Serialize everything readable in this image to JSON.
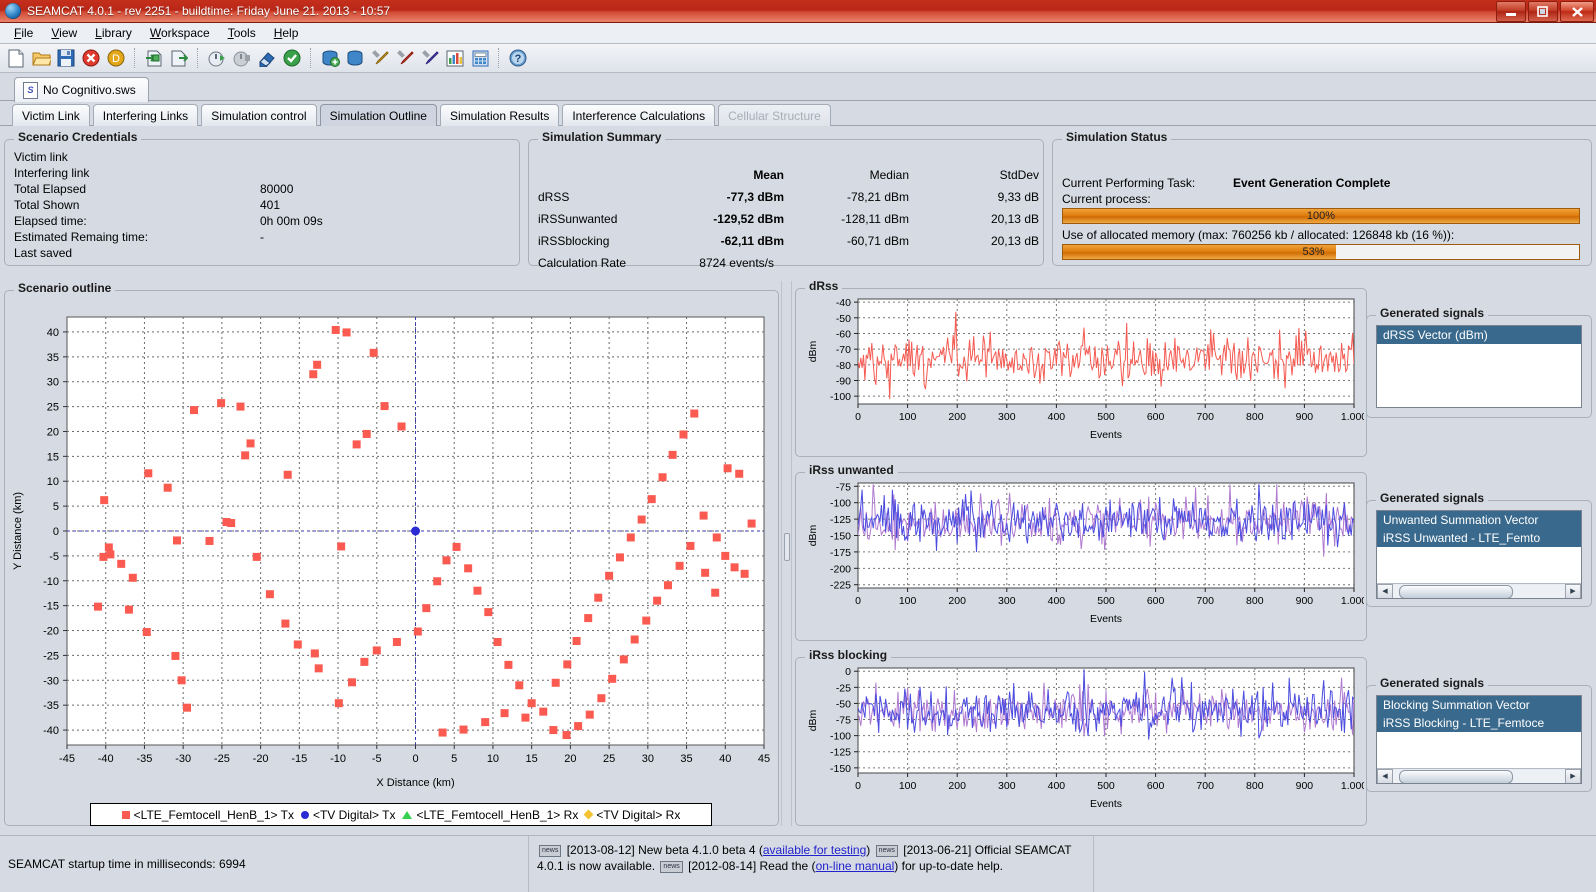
{
  "window": {
    "title": "SEAMCAT 4.0.1 - rev 2251 - buildtime: Friday June 21. 2013 - 10:57",
    "minimize": "—",
    "maximize": "❐",
    "close": "✕"
  },
  "menubar": {
    "items": [
      "File",
      "View",
      "Library",
      "Workspace",
      "Tools",
      "Help"
    ]
  },
  "toolbar": {
    "icons": [
      {
        "name": "new-file-icon",
        "glyph": "📄"
      },
      {
        "name": "open-folder-icon",
        "glyph": "📂"
      },
      {
        "name": "save-icon",
        "glyph": "💾"
      },
      {
        "name": "delete-icon",
        "glyph": "⊗"
      },
      {
        "name": "duplicate-icon",
        "glyph": "D"
      },
      {
        "name": "import-icon",
        "glyph": "⇥"
      },
      {
        "name": "export-icon",
        "glyph": "⇨"
      },
      {
        "name": "run-simulation-icon",
        "glyph": "⏱"
      },
      {
        "name": "stop-simulation-icon",
        "glyph": "⏱"
      },
      {
        "name": "clear-icon",
        "glyph": "◨"
      },
      {
        "name": "validate-icon",
        "glyph": "✔"
      },
      {
        "name": "new-library-icon",
        "glyph": "🗃"
      },
      {
        "name": "library-icon",
        "glyph": "🗄"
      },
      {
        "name": "tools-yellow-icon",
        "glyph": "⚒"
      },
      {
        "name": "tools-red-icon",
        "glyph": "⚒"
      },
      {
        "name": "tools-blue-icon",
        "glyph": "⚒"
      },
      {
        "name": "chart-icon",
        "glyph": "📊"
      },
      {
        "name": "calculator-icon",
        "glyph": "🧮"
      },
      {
        "name": "help-icon",
        "glyph": "?"
      }
    ]
  },
  "file_tab": {
    "label": "No Cognitivo.sws",
    "icon": "S"
  },
  "main_tabs": [
    {
      "label": "Victim Link",
      "active": false,
      "disabled": false
    },
    {
      "label": "Interfering Links",
      "active": false,
      "disabled": false
    },
    {
      "label": "Simulation control",
      "active": false,
      "disabled": false
    },
    {
      "label": "Simulation Outline",
      "active": true,
      "disabled": false
    },
    {
      "label": "Simulation Results",
      "active": false,
      "disabled": false
    },
    {
      "label": "Interference Calculations",
      "active": false,
      "disabled": false
    },
    {
      "label": "Cellular Structure",
      "active": false,
      "disabled": true
    }
  ],
  "scenario_credentials": {
    "title": "Scenario Credentials",
    "rows": [
      {
        "label": "Victim link",
        "value": ""
      },
      {
        "label": "Interfering link",
        "value": ""
      },
      {
        "label": "Total Elapsed",
        "value": "80000"
      },
      {
        "label": "Total Shown",
        "value": "401"
      },
      {
        "label": "Elapsed time:",
        "value": "0h 00m 09s"
      },
      {
        "label": "Estimated Remaing time:",
        "value": "-"
      },
      {
        "label": "Last saved",
        "value": ""
      }
    ]
  },
  "simulation_summary": {
    "title": "Simulation Summary",
    "headers": [
      "",
      "Mean",
      "Median",
      "StdDev"
    ],
    "rows": [
      {
        "name": "dRSS",
        "mean": "-77,3 dBm",
        "median": "-78,21 dBm",
        "stddev": "9,33 dB"
      },
      {
        "name": "iRSSunwanted",
        "mean": "-129,52 dBm",
        "median": "-128,11 dBm",
        "stddev": "20,13 dB"
      },
      {
        "name": "iRSSblocking",
        "mean": "-62,11 dBm",
        "median": "-60,71 dBm",
        "stddev": "20,13 dB"
      },
      {
        "name": "Calculation Rate",
        "mean": "8724 events/s",
        "median": "",
        "stddev": ""
      }
    ]
  },
  "simulation_status": {
    "title": "Simulation Status",
    "task_label": "Current Performing Task:",
    "task_value": "Event Generation Complete",
    "process_label": "Current process:",
    "process_percent": 100,
    "process_text": "100%",
    "memory_label": "Use of allocated memory (max: 760256 kb / allocated: 126848 kb (16 %)):",
    "memory_percent": 53,
    "memory_text": "53%",
    "bar_color": "#e07e10"
  },
  "scenario_outline": {
    "title": "Scenario outline",
    "legend": [
      {
        "marker": "square",
        "color": "#fa5a50",
        "label": "<LTE_Femtocell_HenB_1> Tx"
      },
      {
        "marker": "circle",
        "color": "#2b2bd4",
        "label": "<TV Digital> Tx"
      },
      {
        "marker": "triangle",
        "color": "#33d14f",
        "label": "<LTE_Femtocell_HenB_1> Rx"
      },
      {
        "marker": "diamond",
        "color": "#f2c231",
        "label": "<TV Digital> Rx"
      }
    ]
  },
  "chart_data": [
    {
      "id": "scenario-outline-scatter",
      "type": "scatter",
      "title": "Scenario outline",
      "xlabel": "X Distance (km)",
      "ylabel": "Y Distance (km)",
      "xlim": [
        -45,
        45
      ],
      "ylim": [
        -43,
        43
      ],
      "xticks": [
        -45,
        -40,
        -35,
        -30,
        -25,
        -20,
        -15,
        -10,
        -5,
        0,
        5,
        10,
        15,
        20,
        25,
        30,
        35,
        40,
        45
      ],
      "yticks": [
        -40,
        -35,
        -30,
        -25,
        -20,
        -15,
        -10,
        -5,
        0,
        5,
        10,
        15,
        20,
        25,
        30,
        35,
        40
      ],
      "grid": true,
      "crosshair": {
        "x": 0,
        "y": 0,
        "color": "#3a3ab0"
      },
      "series": [
        {
          "name": "<LTE_Femtocell_HenB_1> Tx",
          "marker": "square",
          "color": "#fa5a50",
          "points": [
            [
              -40.2,
              6.2
            ],
            [
              -34.5,
              11.6
            ],
            [
              -30.8,
              -1.9
            ],
            [
              -32.0,
              8.7
            ],
            [
              -28.6,
              24.3
            ],
            [
              -25.1,
              25.7
            ],
            [
              -22.6,
              25.0
            ],
            [
              -21.3,
              17.6
            ],
            [
              -22.0,
              15.2
            ],
            [
              -16.5,
              11.3
            ],
            [
              -13.2,
              31.5
            ],
            [
              -12.7,
              33.4
            ],
            [
              -10.3,
              40.4
            ],
            [
              -8.9,
              39.9
            ],
            [
              -5.4,
              35.8
            ],
            [
              -6.3,
              19.5
            ],
            [
              -7.6,
              17.4
            ],
            [
              -4.0,
              25.1
            ],
            [
              -1.8,
              21.0
            ],
            [
              -9.6,
              -3.1
            ],
            [
              -39.6,
              -3.3
            ],
            [
              -40.3,
              -5.2
            ],
            [
              -39.4,
              -4.7
            ],
            [
              -38.0,
              -6.6
            ],
            [
              -36.5,
              -9.4
            ],
            [
              -41.0,
              -15.2
            ],
            [
              -37.0,
              -15.8
            ],
            [
              -34.7,
              -20.3
            ],
            [
              -31.0,
              -25.1
            ],
            [
              -30.2,
              -30.0
            ],
            [
              -29.5,
              -35.5
            ],
            [
              -26.6,
              -2.0
            ],
            [
              -24.4,
              1.8
            ],
            [
              -23.8,
              1.6
            ],
            [
              -20.5,
              -5.2
            ],
            [
              -18.8,
              -12.7
            ],
            [
              -16.8,
              -18.6
            ],
            [
              -15.2,
              -22.8
            ],
            [
              -13.0,
              -24.6
            ],
            [
              -12.5,
              -27.6
            ],
            [
              -9.9,
              -34.6
            ],
            [
              -8.2,
              -30.4
            ],
            [
              -6.6,
              -26.3
            ],
            [
              -5.0,
              -24.0
            ],
            [
              -2.4,
              -22.3
            ],
            [
              0.3,
              -20.2
            ],
            [
              1.4,
              -15.5
            ],
            [
              2.8,
              -10.1
            ],
            [
              4.0,
              -5.9
            ],
            [
              5.3,
              -3.2
            ],
            [
              6.8,
              -7.5
            ],
            [
              8.0,
              -12.0
            ],
            [
              9.4,
              -16.3
            ],
            [
              10.6,
              -22.3
            ],
            [
              12.0,
              -26.9
            ],
            [
              13.4,
              -31.0
            ],
            [
              15.0,
              -34.6
            ],
            [
              16.5,
              -36.3
            ],
            [
              18.1,
              -30.5
            ],
            [
              19.6,
              -26.8
            ],
            [
              20.8,
              -22.1
            ],
            [
              22.3,
              -17.5
            ],
            [
              23.6,
              -13.4
            ],
            [
              25.0,
              -9.0
            ],
            [
              26.4,
              -5.3
            ],
            [
              27.8,
              -1.3
            ],
            [
              29.2,
              2.3
            ],
            [
              30.5,
              6.4
            ],
            [
              31.9,
              10.8
            ],
            [
              33.2,
              15.3
            ],
            [
              34.6,
              19.4
            ],
            [
              36.0,
              23.6
            ],
            [
              37.4,
              -8.4
            ],
            [
              38.7,
              -12.4
            ],
            [
              40.0,
              -5.0
            ],
            [
              41.2,
              -7.3
            ],
            [
              42.5,
              -8.6
            ],
            [
              43.4,
              1.5
            ],
            [
              41.8,
              11.5
            ],
            [
              40.3,
              12.6
            ],
            [
              38.9,
              -1.3
            ],
            [
              37.2,
              3.1
            ],
            [
              35.5,
              -3.0
            ],
            [
              34.1,
              -7.0
            ],
            [
              32.6,
              -10.9
            ],
            [
              31.2,
              -14.0
            ],
            [
              29.8,
              -18.0
            ],
            [
              28.3,
              -21.8
            ],
            [
              26.9,
              -25.8
            ],
            [
              25.4,
              -29.7
            ],
            [
              24.0,
              -33.6
            ],
            [
              22.5,
              -36.9
            ],
            [
              21.0,
              -39.2
            ],
            [
              19.5,
              -41.0
            ],
            [
              17.8,
              -40.0
            ],
            [
              14.2,
              -37.5
            ],
            [
              11.5,
              -36.6
            ],
            [
              9.0,
              -38.4
            ],
            [
              6.2,
              -39.9
            ],
            [
              3.5,
              -40.5
            ]
          ]
        },
        {
          "name": "<TV Digital> Tx",
          "marker": "circle",
          "color": "#2b2bd4",
          "points": [
            [
              0,
              0
            ]
          ]
        }
      ]
    },
    {
      "id": "drss-chart",
      "type": "line",
      "title": "dRss",
      "xlabel": "Events",
      "ylabel": "dBm",
      "xlim": [
        0,
        1000
      ],
      "ylim": [
        -105,
        -38
      ],
      "xticks": [
        0,
        100,
        200,
        300,
        400,
        500,
        600,
        700,
        800,
        900,
        1000
      ],
      "xticklabels": [
        "0",
        "100",
        "200",
        "300",
        "400",
        "500",
        "600",
        "700",
        "800",
        "900",
        "1.000"
      ],
      "yticks": [
        -100,
        -90,
        -80,
        -70,
        -60,
        -50,
        -40
      ],
      "grid": true,
      "series": [
        {
          "name": "dRSS Vector (dBm)",
          "color": "#f55b52",
          "mean": -77.3,
          "stddev": 9.33,
          "n": 1000
        }
      ]
    },
    {
      "id": "irss-unwanted-chart",
      "type": "line",
      "title": "iRss unwanted",
      "xlabel": "Events",
      "ylabel": "dBm",
      "xlim": [
        0,
        1000
      ],
      "ylim": [
        -230,
        -70
      ],
      "xticks": [
        0,
        100,
        200,
        300,
        400,
        500,
        600,
        700,
        800,
        900,
        1000
      ],
      "xticklabels": [
        "0",
        "100",
        "200",
        "300",
        "400",
        "500",
        "600",
        "700",
        "800",
        "900",
        "1.000"
      ],
      "yticks": [
        -225,
        -200,
        -175,
        -150,
        -125,
        -100,
        -75
      ],
      "grid": true,
      "series": [
        {
          "name": "Unwanted Summation Vector",
          "color": "#4b4be0",
          "mean": -129.52,
          "stddev": 20.13,
          "n": 1000
        },
        {
          "name": "iRSS Unwanted - LTE_Femto",
          "color": "#b07ad0",
          "mean": -130.5,
          "stddev": 20.13,
          "n": 1000
        }
      ]
    },
    {
      "id": "irss-blocking-chart",
      "type": "line",
      "title": "iRss blocking",
      "xlabel": "Events",
      "ylabel": "dBm",
      "xlim": [
        0,
        1000
      ],
      "ylim": [
        -158,
        5
      ],
      "xticks": [
        0,
        100,
        200,
        300,
        400,
        500,
        600,
        700,
        800,
        900,
        1000
      ],
      "xticklabels": [
        "0",
        "100",
        "200",
        "300",
        "400",
        "500",
        "600",
        "700",
        "800",
        "900",
        "1.000"
      ],
      "yticks": [
        -150,
        -125,
        -100,
        -75,
        -50,
        -25,
        0
      ],
      "grid": true,
      "series": [
        {
          "name": "Blocking Summation Vector",
          "color": "#4b4be0",
          "mean": -62.11,
          "stddev": 20.13,
          "n": 1000
        },
        {
          "name": "iRSS Blocking - LTE_Femtoce",
          "color": "#b07ad0",
          "mean": -63.0,
          "stddev": 20.13,
          "n": 1000
        }
      ]
    }
  ],
  "generated_signals": [
    {
      "title": "Generated signals",
      "items": [
        "dRSS Vector (dBm)"
      ],
      "scrollbar": false
    },
    {
      "title": "Generated signals",
      "items": [
        "Unwanted Summation Vector",
        "iRSS Unwanted - LTE_Femto"
      ],
      "scrollbar": true
    },
    {
      "title": "Generated signals",
      "items": [
        "Blocking Summation Vector",
        "iRSS Blocking - LTE_Femtoce"
      ],
      "scrollbar": true
    }
  ],
  "chart_panels": [
    {
      "title": "dRss"
    },
    {
      "title": "iRss unwanted"
    },
    {
      "title": "iRss blocking"
    }
  ],
  "statusbar": {
    "left_text": "SEAMCAT startup time in milliseconds: 6994",
    "news_badge": "news",
    "news": [
      {
        "date": "[2013-08-12]",
        "text": "New beta 4.1.0 beta 4 (",
        "link": "available for testing",
        "after": ")"
      },
      {
        "date": "[2013-06-21]",
        "text": "Official SEAMCAT 4.0.1 is now available.",
        "link": "",
        "after": ""
      },
      {
        "date": "[2012-08-14]",
        "text": "Read the (",
        "link": "on-line manual",
        "after": ") for up-to-date help."
      }
    ]
  }
}
